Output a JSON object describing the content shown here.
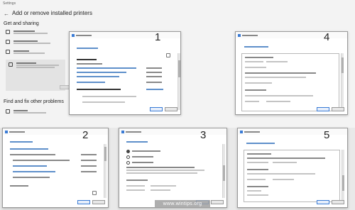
{
  "settings_page": {
    "window_title": "Settings",
    "page_title": "Add or remove installed printers",
    "section_1": "Get and sharing",
    "section_2": "Find and fix other problems",
    "back_glyph": "←"
  },
  "dialogs": [
    {
      "label": "1"
    },
    {
      "label": "2"
    },
    {
      "label": "3"
    },
    {
      "label": "4"
    },
    {
      "label": "5"
    }
  ],
  "watermark": "www.wintips.org",
  "colors": {
    "accent": "#1a5fb4",
    "window_bg": "#ffffff",
    "desktop_bg": "#e9e9e9"
  }
}
